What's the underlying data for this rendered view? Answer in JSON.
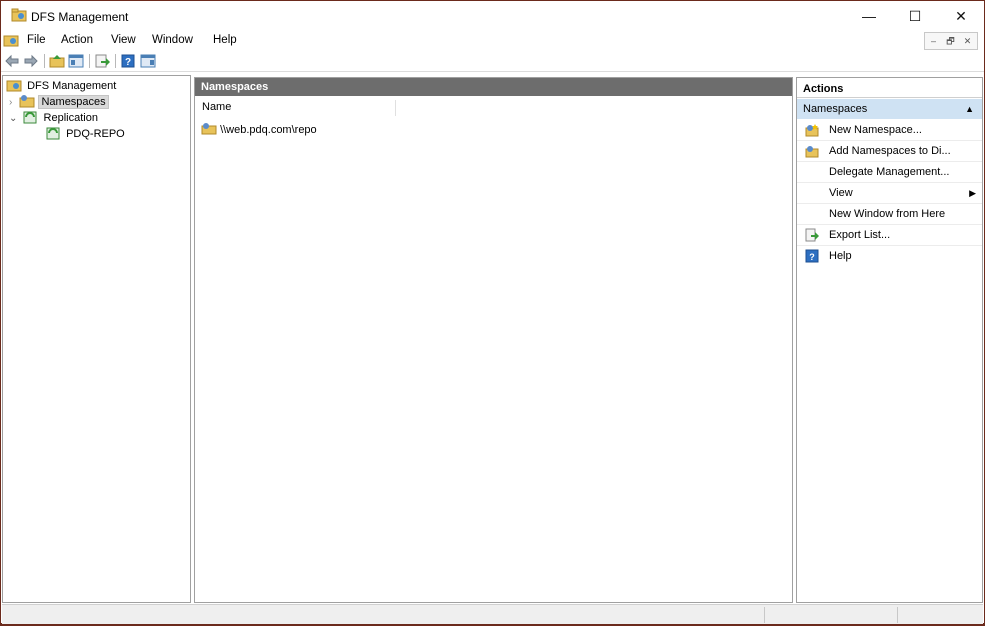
{
  "window": {
    "title": "DFS Management",
    "minimize": "—",
    "maximize": "☐",
    "close": "✕"
  },
  "menu": {
    "items": [
      "File",
      "Action",
      "View",
      "Window",
      "Help"
    ],
    "mdi": [
      "–",
      "🗗",
      "✕"
    ]
  },
  "toolbar": {
    "buttons": [
      "back-icon",
      "forward-icon",
      "up-folder-icon",
      "show-hide-tree-icon",
      "export-list-icon",
      "help-icon",
      "show-hide-action-pane-icon"
    ]
  },
  "tree": {
    "root": "DFS Management",
    "items": [
      {
        "label": "Namespaces",
        "selected": true
      },
      {
        "label": "Replication",
        "expanded": true
      },
      {
        "label": "PDQ-REPO"
      }
    ]
  },
  "center": {
    "header": "Namespaces",
    "column": "Name",
    "rows": [
      "\\\\web.pdq.com\\repo"
    ]
  },
  "actions": {
    "header": "Actions",
    "section": "Namespaces",
    "items": [
      {
        "label": "New Namespace...",
        "icon": "new-namespace-icon"
      },
      {
        "label": "Add Namespaces to Di...",
        "icon": "add-namespace-icon"
      },
      {
        "label": "Delegate Management...",
        "icon": ""
      },
      {
        "label": "View",
        "icon": "",
        "submenu": true
      },
      {
        "label": "New Window from Here",
        "icon": ""
      },
      {
        "label": "Export List...",
        "icon": "export-list-icon"
      },
      {
        "label": "Help",
        "icon": "help-icon"
      }
    ]
  },
  "colors": {
    "paneHeader": "#6d6d6d",
    "actionSection": "#cfe2f3",
    "frame": "#6b2a1c"
  }
}
